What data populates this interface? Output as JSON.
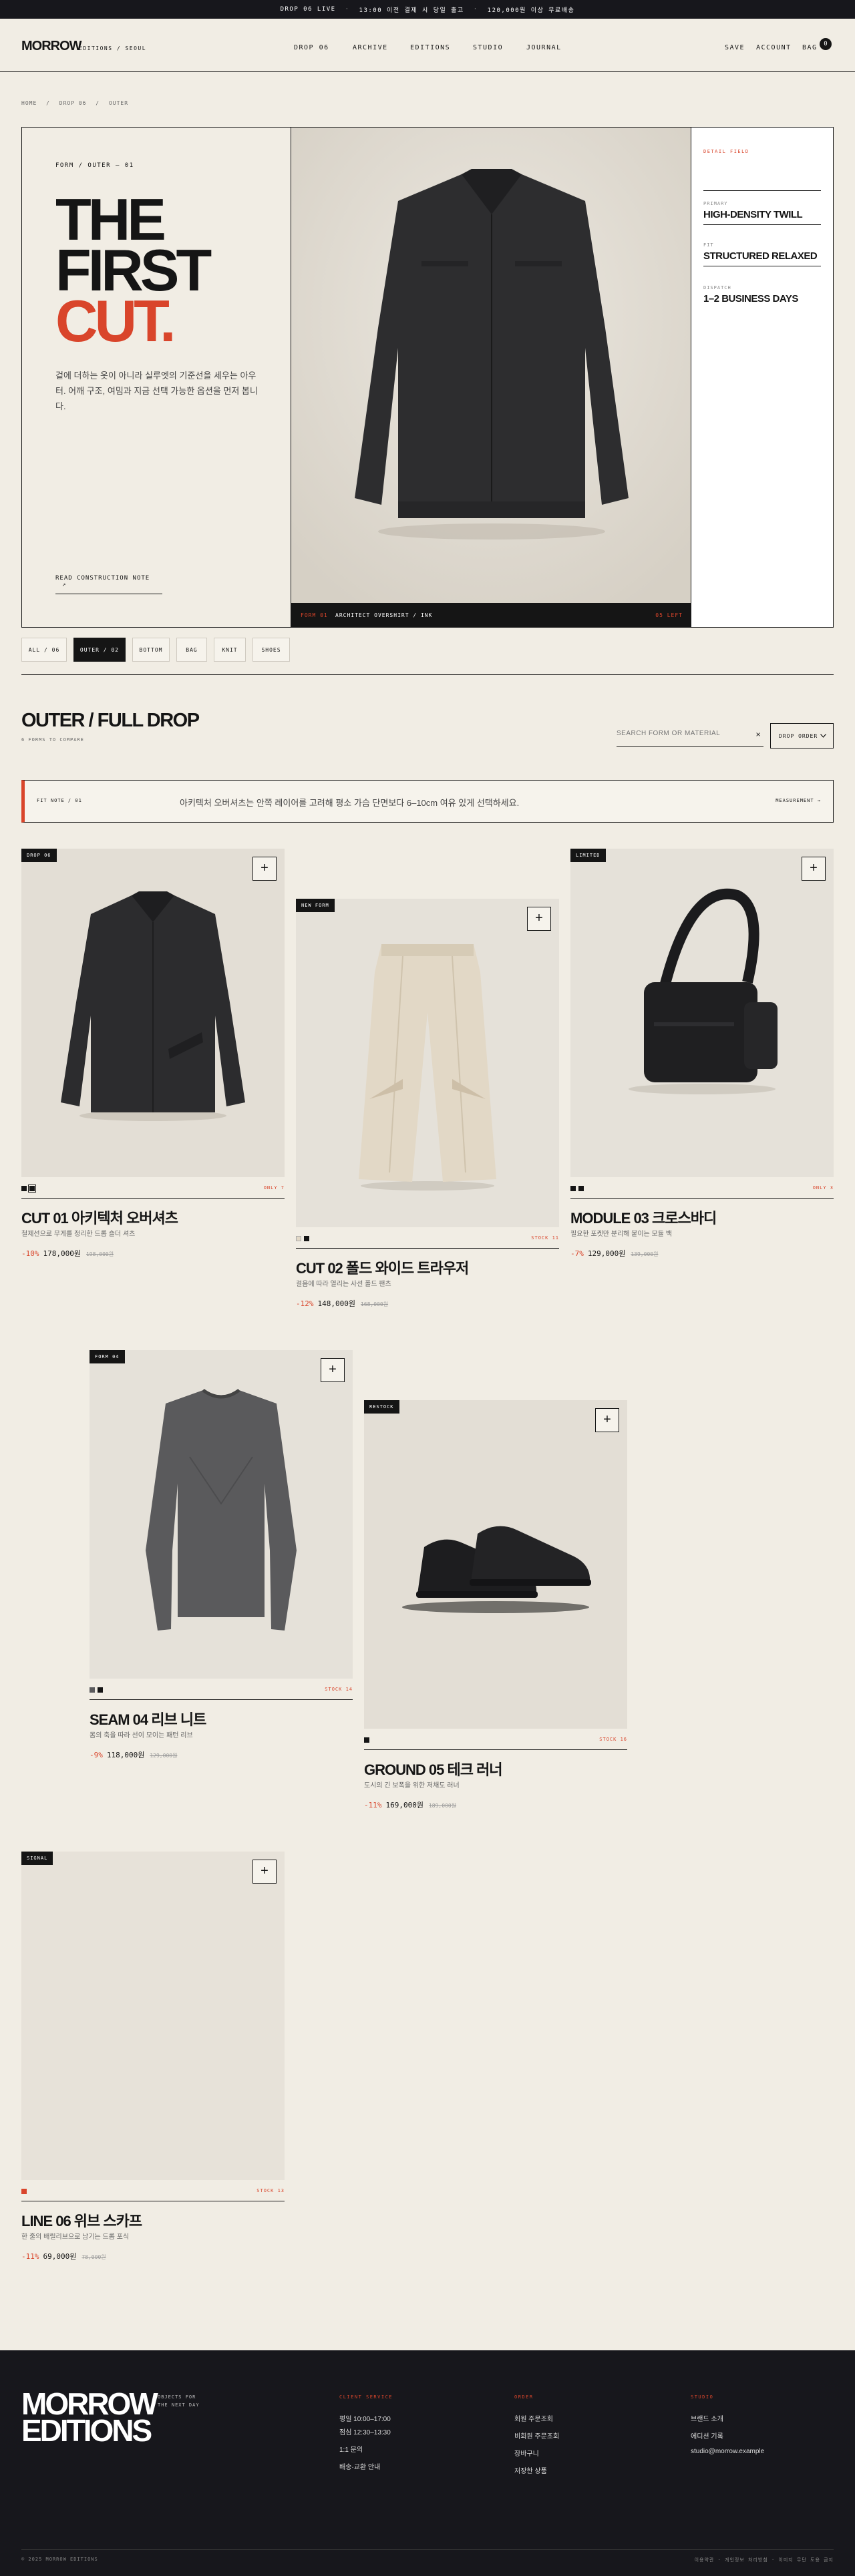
{
  "topbar": {
    "items": [
      "DROP 06 LIVE",
      "13:00 이전 결제 시 당일 출고",
      "120,000원 이상 무료배송"
    ],
    "sep": "·"
  },
  "header": {
    "logo": "MORROW",
    "logo_sub": "EDITIONS / SEOUL",
    "nav": [
      "DROP 06",
      "ARCHIVE",
      "EDITIONS",
      "STUDIO",
      "JOURNAL"
    ],
    "save": "SAVE",
    "account": "ACCOUNT",
    "bag": "BAG",
    "bag_count": "0"
  },
  "breadcrumb": {
    "items": [
      "HOME",
      "DROP 06",
      "OUTER"
    ],
    "sep": "/"
  },
  "hero": {
    "eyebrow": "FORM / OUTER — 01",
    "title_1": "THE",
    "title_2": "FIRST",
    "title_3": "CUT.",
    "description": "겉에 더하는 옷이 아니라 실루엣의 기준선을 세우는 아우터. 어깨 구조, 여밈과 지금 선택 가능한 옵션을 먼저 봅니다.",
    "read_note": "READ CONSTRUCTION NOTE",
    "read_arrow": "↗",
    "caption_tag": "FORM 01",
    "caption_name": "ARCHITECT OVERSHIRT / INK",
    "caption_stock": "05 LEFT",
    "spec_head": "DETAIL FIELD",
    "specs": [
      {
        "label": "PRIMARY",
        "value": "HIGH-DENSITY TWILL"
      },
      {
        "label": "FIT",
        "value": "STRUCTURED RELAXED"
      },
      {
        "label": "DISPATCH",
        "value": "1–2 BUSINESS DAYS"
      }
    ]
  },
  "filters": [
    "ALL / 06",
    "OUTER / 02",
    "BOTTOM",
    "BAG",
    "KNIT",
    "SHOES"
  ],
  "section": {
    "title": "OUTER / FULL DROP",
    "subtitle": "6 FORMS TO COMPARE",
    "search_placeholder": "SEARCH FORM OR MATERIAL",
    "search_clear": "×",
    "sort": "DROP ORDER"
  },
  "fit_note": {
    "tag": "FIT NOTE / 01",
    "text": "아키텍처 오버셔츠는 안쪽 레이어를 고려해 평소 가슴 단면보다 6–10cm 여유 있게 선택하세요.",
    "action": "MEASUREMENT →"
  },
  "products": [
    {
      "badge": "DROP 06",
      "name": "CUT 01 아키텍처 오버셔츠",
      "desc": "철제선으로 무게를 정리한 드롭 숄더 셔츠",
      "discount": "-10%",
      "price": "178,000원",
      "orig": "198,000원",
      "stock": "ONLY 7",
      "plus": "+"
    },
    {
      "badge": "NEW FORM",
      "name": "CUT 02 폴드 와이드 트라우저",
      "desc": "걸음에 따라 열리는 사선 폴드 팬츠",
      "discount": "-12%",
      "price": "148,000원",
      "orig": "168,000원",
      "stock": "STOCK 11",
      "plus": "+"
    },
    {
      "badge": "LIMITED",
      "name": "MODULE 03 크로스바디",
      "desc": "필요한 포켓만 분리해 붙이는 모듈 백",
      "discount": "-7%",
      "price": "129,000원",
      "orig": "139,000원",
      "stock": "ONLY 3",
      "plus": "+"
    },
    {
      "badge": "FORM 04",
      "name": "SEAM 04 리브 니트",
      "desc": "몸의 축을 따라 선이 모이는 패턴 리브",
      "discount": "-9%",
      "price": "118,000원",
      "orig": "129,000원",
      "stock": "STOCK 14",
      "plus": "+"
    },
    {
      "badge": "RESTOCK",
      "name": "GROUND 05 테크 러너",
      "desc": "도시의 긴 보폭을 위한 저채도 러너",
      "discount": "-11%",
      "price": "169,000원",
      "orig": "189,000원",
      "stock": "STOCK 16",
      "plus": "+"
    },
    {
      "badge": "SIGNAL",
      "name": "LINE 06 위브 스카프",
      "desc": "한 줄의 배릴리브으로 남기는 드롭 포식",
      "discount": "-11%",
      "price": "69,000원",
      "orig": "78,000원",
      "stock": "STOCK 13",
      "plus": "+"
    }
  ],
  "footer": {
    "logo_1": "MORROW",
    "logo_2": "EDITIONS",
    "tagline": "OBJECTS FOR THE NEXT DAY",
    "cols": [
      {
        "head": "CLIENT SERVICE",
        "links": [
          "평일 10:00–17:00",
          "점심 12:30–13:30",
          "1:1 문의",
          "배송·교환 안내"
        ]
      },
      {
        "head": "ORDER",
        "links": [
          "회원 주문조회",
          "비회원 주문조회",
          "장바구니",
          "저장한 상품"
        ]
      },
      {
        "head": "STUDIO",
        "links": [
          "브랜드 소개",
          "에디션 기록",
          "studio@morrow.example"
        ]
      }
    ],
    "copyright": "© 2025 MORROW EDITIONS",
    "legal": "이용약관 · 개인정보 처리방침 · 이미지 무단 도용 금지"
  }
}
